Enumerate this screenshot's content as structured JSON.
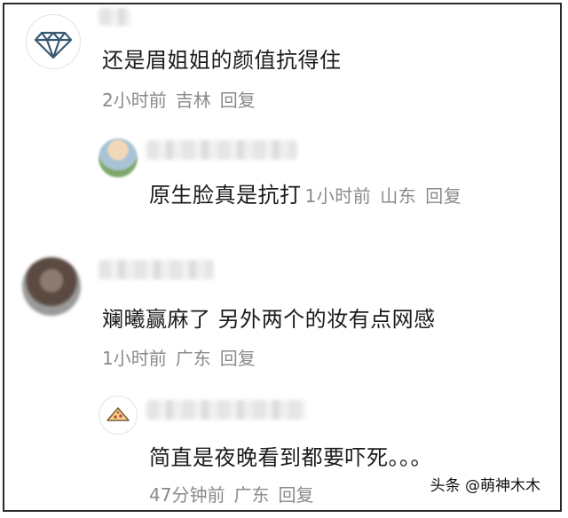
{
  "comments": [
    {
      "text": "还是眉姐姐的颜值抗得住",
      "time": "2小时前",
      "location": "吉林",
      "reply": "回复",
      "avatar_icon": "diamond-icon"
    },
    {
      "text": "原生脸真是抗打",
      "time": "1小时前",
      "location": "山东",
      "reply": "回复"
    },
    {
      "text": "斓曦赢麻了 另外两个的妆有点网感",
      "time": "1小时前",
      "location": "广东",
      "reply": "回复"
    },
    {
      "text": "简直是夜晚看到都要吓死。。。",
      "time": "47分钟前",
      "location": "广东",
      "reply": "回复",
      "avatar_icon": "pizza-icon"
    }
  ],
  "watermark": "头条 @萌神木木",
  "colors": {
    "meta_text": "#8a8a8a",
    "body_text": "#1b1b1b",
    "border": "#2a2a2a"
  }
}
